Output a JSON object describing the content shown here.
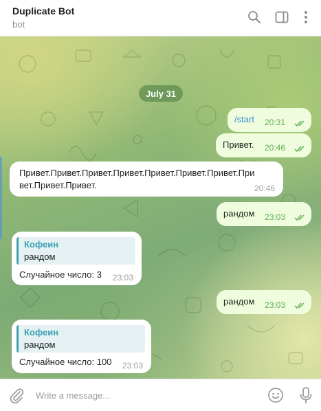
{
  "header": {
    "title": "Duplicate Bot",
    "status": "bot",
    "icons": [
      "search-icon",
      "sidebar-toggle-icon",
      "more-vertical-icon"
    ]
  },
  "date_divider": "July 31",
  "messages": [
    {
      "id": "m1",
      "direction": "outgoing",
      "text": "/start",
      "time": "20:31",
      "read": true
    },
    {
      "id": "m2",
      "direction": "outgoing",
      "text": "Привет.",
      "time": "20:46",
      "read": true
    },
    {
      "id": "m3",
      "direction": "incoming",
      "text_line1": "Привет.Привет.Привет.Привет.Привет.Привет.Привет.При",
      "text_line2": "вет.Привет.Привет.",
      "time": "20:46"
    },
    {
      "id": "m4",
      "direction": "outgoing",
      "text": "рандом",
      "time": "23:03",
      "read": true
    },
    {
      "id": "m5",
      "direction": "incoming",
      "reply_author": "Кофеин",
      "reply_text": "рандом",
      "text": "Случайное число: 3",
      "time": "23:03"
    },
    {
      "id": "m6",
      "direction": "outgoing",
      "text": "рандом",
      "time": "23:03",
      "read": true
    },
    {
      "id": "m7",
      "direction": "incoming",
      "reply_author": "Кофеин",
      "reply_text": "рандом",
      "text": "Случайное число: 100",
      "time": "23:03"
    }
  ],
  "composer": {
    "placeholder": "Write a message...",
    "icons": [
      "paperclip-icon",
      "emoji-icon",
      "microphone-icon"
    ]
  },
  "colors": {
    "outgoing_bubble": "#effdde",
    "incoming_bubble": "#ffffff",
    "read_check": "#5fb052",
    "reply_accent": "#3ba1b5",
    "link": "#3a8fd6"
  }
}
